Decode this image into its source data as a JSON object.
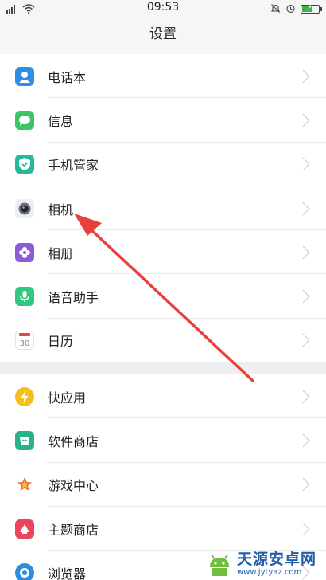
{
  "status_bar": {
    "time": "09:53",
    "icons": [
      "signal-icon",
      "wifi-icon",
      "silent-bell-icon",
      "alarm-icon",
      "battery-charging-icon"
    ],
    "battery_level": 0.55
  },
  "header": {
    "title": "设置"
  },
  "group1": [
    {
      "label": "电话本",
      "icon": "contacts-icon",
      "color": "#2f8de8"
    },
    {
      "label": "信息",
      "icon": "messages-icon",
      "color": "#3bc564"
    },
    {
      "label": "手机管家",
      "icon": "phone-manager-shield-icon",
      "color": "#25b89a"
    },
    {
      "label": "相机",
      "icon": "camera-icon",
      "color": "#6b6f78"
    },
    {
      "label": "相册",
      "icon": "gallery-flower-icon",
      "color": "#8a5cd8"
    },
    {
      "label": "语音助手",
      "icon": "voice-assistant-mic-icon",
      "color": "#31c781"
    },
    {
      "label": "日历",
      "icon": "calendar-icon",
      "color": "#e04a3a",
      "calendar_day": "30"
    }
  ],
  "group2": [
    {
      "label": "快应用",
      "icon": "quick-app-bolt-icon",
      "color": "#f4be1c"
    },
    {
      "label": "软件商店",
      "icon": "app-store-icon",
      "color": "#27b28c"
    },
    {
      "label": "游戏中心",
      "icon": "game-center-star-icon",
      "color": "#f06a3a"
    },
    {
      "label": "主题商店",
      "icon": "theme-store-icon",
      "color": "#e9455c"
    },
    {
      "label": "浏览器",
      "icon": "browser-icon",
      "color": "#2a8ee0"
    }
  ],
  "watermark": {
    "text": "天源安卓网",
    "url": "www.jytyaz.com"
  },
  "accent": {
    "arrow": "#e8403a",
    "divider": "#ececec",
    "background": "#f6f6f6"
  }
}
